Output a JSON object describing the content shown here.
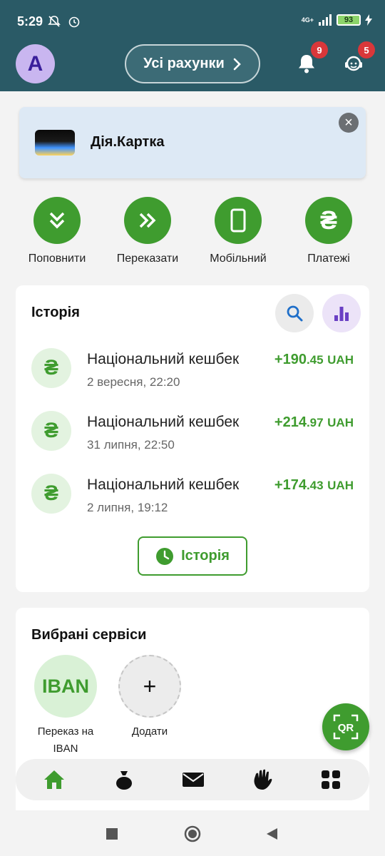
{
  "status_bar": {
    "time": "5:29",
    "network": "4G+",
    "battery": "93"
  },
  "header": {
    "avatar_letter": "A",
    "accounts_button": "Усі рахунки",
    "notifications_badge": "9",
    "support_badge": "5"
  },
  "promo_card": {
    "title": "Дія.Картка"
  },
  "quick_actions": [
    {
      "label": "Поповнити",
      "icon": "double-chevron-down-icon"
    },
    {
      "label": "Переказати",
      "icon": "double-chevron-right-icon"
    },
    {
      "label": "Мобільний",
      "icon": "smartphone-icon"
    },
    {
      "label": "Платежі",
      "icon": "hryvnia-icon"
    }
  ],
  "history": {
    "title": "Історія",
    "currency_glyph": "₴",
    "transactions": [
      {
        "name": "Національний кешбек",
        "date": "2 вересня, 22:20",
        "amount_major": "+190",
        "amount_minor": ".45",
        "currency": "UAH"
      },
      {
        "name": "Національний кешбек",
        "date": "31 липня, 22:50",
        "amount_major": "+214",
        "amount_minor": ".97",
        "currency": "UAH"
      },
      {
        "name": "Національний кешбек",
        "date": "2 липня, 19:12",
        "amount_major": "+174",
        "amount_minor": ".43",
        "currency": "UAH"
      }
    ],
    "button_label": "Історія"
  },
  "services": {
    "title": "Вибрані сервіси",
    "items": [
      {
        "label_line1": "Переказ на",
        "label_line2": "IBAN",
        "icon_text": "IBAN"
      },
      {
        "label_line1": "Додати",
        "label_line2": "",
        "icon_text": "+"
      }
    ]
  },
  "qr_button": {
    "label": "QR"
  },
  "colors": {
    "header": "#2a5a66",
    "accent_green": "#3f9c2f",
    "badge_red": "#d9373a",
    "promo_bg": "#dde9f5"
  }
}
